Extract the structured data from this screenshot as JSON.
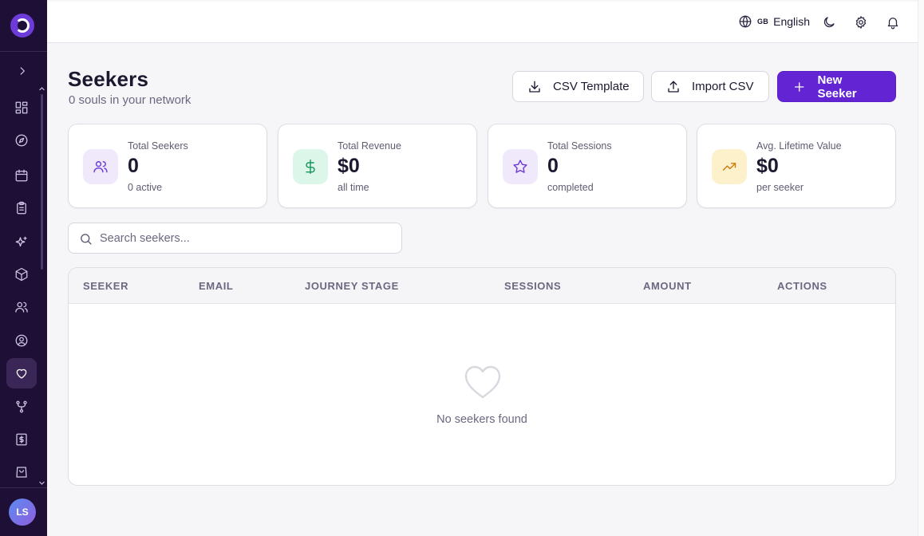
{
  "colors": {
    "sidebar_bg": "#1e0f36",
    "primary": "#6324d4",
    "page_bg": "#f6f6f8"
  },
  "sidebar": {
    "expand_icon": "chevron-right-icon",
    "items": [
      {
        "name": "dashboard",
        "icon": "layout-grid-icon"
      },
      {
        "name": "explore",
        "icon": "compass-icon"
      },
      {
        "name": "calendar",
        "icon": "calendar-icon"
      },
      {
        "name": "tasks",
        "icon": "clipboard-icon"
      },
      {
        "name": "ai",
        "icon": "sparkles-icon"
      },
      {
        "name": "products",
        "icon": "box-icon"
      },
      {
        "name": "users",
        "icon": "users-icon"
      },
      {
        "name": "profile",
        "icon": "user-circle-icon"
      },
      {
        "name": "seekers",
        "icon": "heart-icon",
        "active": true
      },
      {
        "name": "workflows",
        "icon": "git-fork-icon"
      },
      {
        "name": "billing",
        "icon": "receipt-dollar-icon"
      },
      {
        "name": "shop",
        "icon": "shopping-bag-icon"
      }
    ],
    "avatar_initials": "LS"
  },
  "topbar": {
    "language_flag": "GB",
    "language_label": "English"
  },
  "header": {
    "title": "Seekers",
    "subtitle": "0 souls in your network"
  },
  "actions": {
    "csv_template": "CSV Template",
    "import_csv": "Import CSV",
    "new_seeker": "New Seeker"
  },
  "stats": [
    {
      "label": "Total Seekers",
      "value": "0",
      "sub": "0 active",
      "icon": "users-icon",
      "bg": "#efe9fb",
      "fg": "#6a3bd6"
    },
    {
      "label": "Total Revenue",
      "value": "$0",
      "sub": "all time",
      "icon": "dollar-icon",
      "bg": "#dcf7ea",
      "fg": "#17955c"
    },
    {
      "label": "Total Sessions",
      "value": "0",
      "sub": "completed",
      "icon": "star-icon",
      "bg": "#efe9fb",
      "fg": "#6a3bd6"
    },
    {
      "label": "Avg. Lifetime Value",
      "value": "$0",
      "sub": "per seeker",
      "icon": "trending-up-icon",
      "bg": "#fdf1cc",
      "fg": "#cf7d10"
    }
  ],
  "search": {
    "placeholder": "Search seekers..."
  },
  "table": {
    "columns": [
      "Seeker",
      "Email",
      "Journey Stage",
      "Sessions",
      "Amount",
      "Actions"
    ],
    "empty_text": "No seekers found"
  }
}
